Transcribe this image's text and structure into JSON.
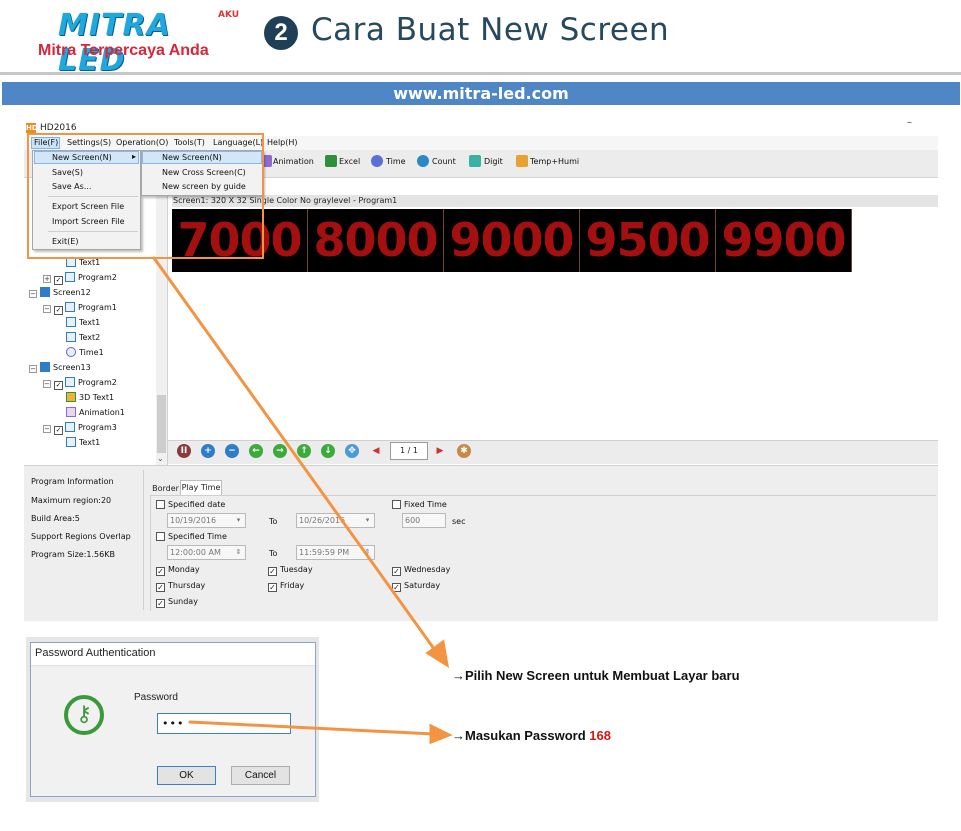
{
  "header": {
    "logo": "MITRA LED",
    "logo_badge": "AKU",
    "tagline": "Mitra Terpercaya Anda",
    "step_number": "2",
    "title": "Cara Buat New Screen",
    "url": "www.mitra-led.com"
  },
  "app": {
    "icon": "HD",
    "title": "HD2016",
    "minimize": "–",
    "menu": [
      "File(F)",
      "Settings(S)",
      "Operation(O)",
      "Tools(T)",
      "Language(L)",
      "Help(H)"
    ],
    "toolbar": [
      "Animation",
      "Excel",
      "Time",
      "Count",
      "Digit",
      "Temp+Humi"
    ],
    "file_menu": {
      "items": [
        "New Screen(N)",
        "Save(S)",
        "Save As...",
        "Export Screen File",
        "Import Screen File",
        "Exit(E)"
      ],
      "submenu_arrow": "▸"
    },
    "submenu": [
      "New Screen(N)",
      "New Cross Screen(C)",
      "New screen by guide"
    ],
    "tree": [
      {
        "label": "Text1"
      },
      {
        "label": "Program2"
      },
      {
        "label": "Screen12"
      },
      {
        "label": "Program1"
      },
      {
        "label": "Text1"
      },
      {
        "label": "Text2"
      },
      {
        "label": "Time1"
      },
      {
        "label": "Screen13"
      },
      {
        "label": "Program2"
      },
      {
        "label": "3D Text1"
      },
      {
        "label": "Animation1"
      },
      {
        "label": "Program3"
      },
      {
        "label": "Text1"
      }
    ],
    "screen_caption": "Screen1: 320 X 32  Single Color No graylevel - Program1",
    "led_values": [
      "7000",
      "8000",
      "9000",
      "9500",
      "9900"
    ],
    "page_indicator": "1 / 1",
    "program_info": {
      "title": "Program Information",
      "max_region": "Maximum region:20",
      "build_area": "Build Area:5",
      "overlap": "Support Regions Overlap",
      "size": "Program Size:1.56KB"
    },
    "tabs": [
      "Border",
      "Play Time"
    ],
    "play_time": {
      "specified_date": "Specified date",
      "date_from": "10/19/2016",
      "to_label": "To",
      "date_to": "10/26/2016",
      "fixed_time": "Fixed Time",
      "fixed_value": "600",
      "sec": "sec",
      "specified_time": "Specified Time",
      "time_from": "12:00:00 AM",
      "time_to": "11:59:59 PM",
      "days": [
        "Monday",
        "Tuesday",
        "Wednesday",
        "Thursday",
        "Friday",
        "Saturday",
        "Sunday"
      ]
    }
  },
  "dialog": {
    "title": "Password Authentication",
    "password_label": "Password",
    "password_value": "•••",
    "ok": "OK",
    "cancel": "Cancel"
  },
  "annotations": {
    "note1": "→Pilih New Screen untuk Membuat  Layar baru",
    "note2_prefix": "→Masukan Password ",
    "note2_value": "168"
  },
  "colors": {
    "accent_orange": "#f39443",
    "url_bar": "#4f86c6",
    "led_red": "#a41010",
    "title_blue": "#27495f"
  }
}
